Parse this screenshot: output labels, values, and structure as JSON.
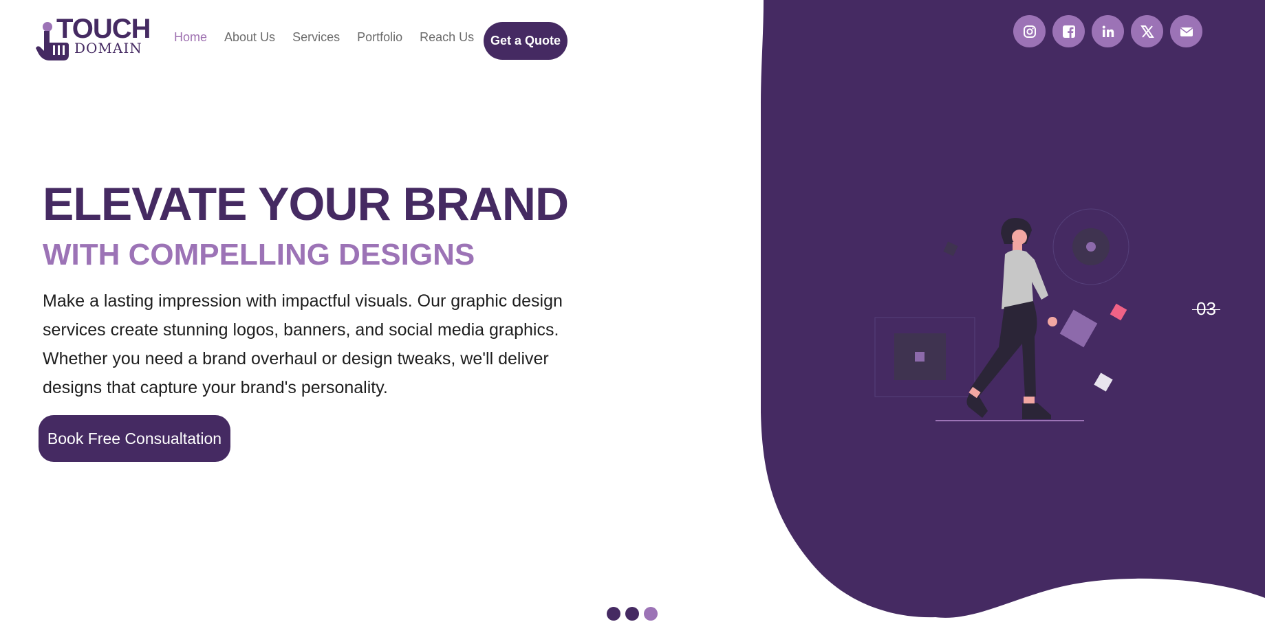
{
  "brand": {
    "logo_word1": "TOUCH",
    "logo_word2": "DOMAIN"
  },
  "nav": {
    "items": [
      {
        "label": "Home",
        "active": true
      },
      {
        "label": "About Us"
      },
      {
        "label": "Services"
      },
      {
        "label": "Portfolio"
      },
      {
        "label": "Reach Us"
      }
    ],
    "quote_button": "Get a Quote"
  },
  "socials": [
    "instagram-icon",
    "facebook-icon",
    "linkedin-icon",
    "x-twitter-icon",
    "email-icon"
  ],
  "hero": {
    "title": "ELEVATE YOUR BRAND",
    "subtitle": "WITH COMPELLING DESIGNS",
    "description": "Make a lasting impression with impactful visuals. Our graphic design services create stunning logos, banners, and social media graphics. Whether you need a brand overhaul or design tweaks, we'll deliver designs that capture your brand's personality.",
    "cta": "Book Free Consualtation"
  },
  "slider": {
    "number": "03",
    "dots": 3,
    "active_dot": 3
  },
  "colors": {
    "primary": "#452a62",
    "accent": "#9c73b6",
    "text": "#1e1e1e",
    "nav": "#6b6b6b",
    "white": "#ffffff"
  }
}
